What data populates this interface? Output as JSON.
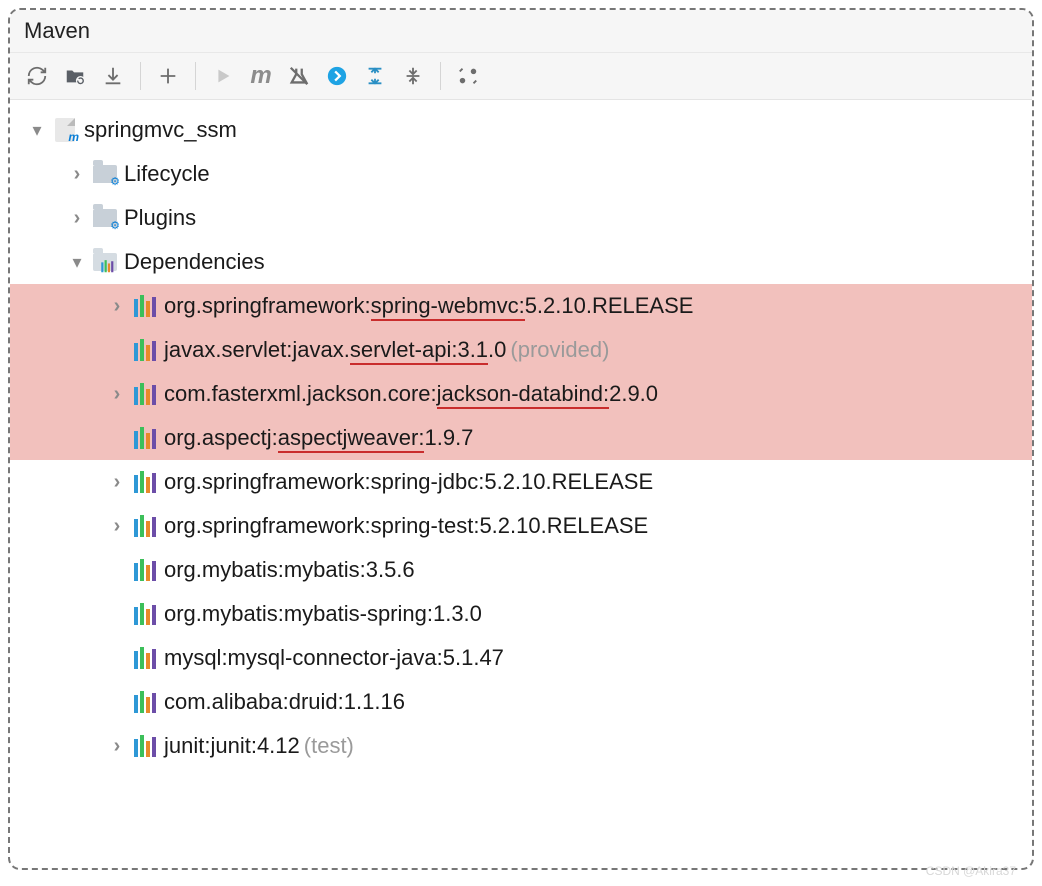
{
  "panel": {
    "title": "Maven"
  },
  "toolbar": {
    "items": [
      "refresh",
      "folder-refresh",
      "download",
      "add",
      "run",
      "maven-m",
      "skip-tests",
      "offline",
      "expand-all",
      "collapse-all",
      "settings"
    ]
  },
  "project": {
    "name": "springmvc_ssm",
    "lifecycle": "Lifecycle",
    "plugins": "Plugins",
    "dependencies": "Dependencies",
    "deps": [
      {
        "prefix": "org.springframework:",
        "ul": "spring-webmvc:",
        "suffix": "5.2.10.RELEASE",
        "scope": "",
        "exp": true,
        "hl": true
      },
      {
        "prefix": "javax.servlet:javax.",
        "ul": "servlet-api:3.1",
        "suffix": ".0",
        "scope": "(provided)",
        "exp": false,
        "hl": true
      },
      {
        "prefix": "com.fasterxml.jackson.core:",
        "ul": "jackson-databind:",
        "suffix": "2.9.0",
        "scope": "",
        "exp": true,
        "hl": true
      },
      {
        "prefix": "org.aspectj:",
        "ul": "aspectjweaver:",
        "suffix": "1.9.7",
        "scope": "",
        "exp": false,
        "hl": true
      },
      {
        "prefix": "org.springframework:spring-jdbc:5.2.10.RELEASE",
        "ul": "",
        "suffix": "",
        "scope": "",
        "exp": true,
        "hl": false
      },
      {
        "prefix": "org.springframework:spring-test:5.2.10.RELEASE",
        "ul": "",
        "suffix": "",
        "scope": "",
        "exp": true,
        "hl": false
      },
      {
        "prefix": "org.mybatis:mybatis:3.5.6",
        "ul": "",
        "suffix": "",
        "scope": "",
        "exp": false,
        "hl": false
      },
      {
        "prefix": "org.mybatis:mybatis-spring:1.3.0",
        "ul": "",
        "suffix": "",
        "scope": "",
        "exp": false,
        "hl": false
      },
      {
        "prefix": "mysql:mysql-connector-java:5.1.47",
        "ul": "",
        "suffix": "",
        "scope": "",
        "exp": false,
        "hl": false
      },
      {
        "prefix": "com.alibaba:druid:1.1.16",
        "ul": "",
        "suffix": "",
        "scope": "",
        "exp": false,
        "hl": false
      },
      {
        "prefix": "junit:junit:4.12",
        "ul": "",
        "suffix": "",
        "scope": "(test)",
        "exp": true,
        "hl": false
      }
    ]
  },
  "watermark": "CSDN @Akira37"
}
